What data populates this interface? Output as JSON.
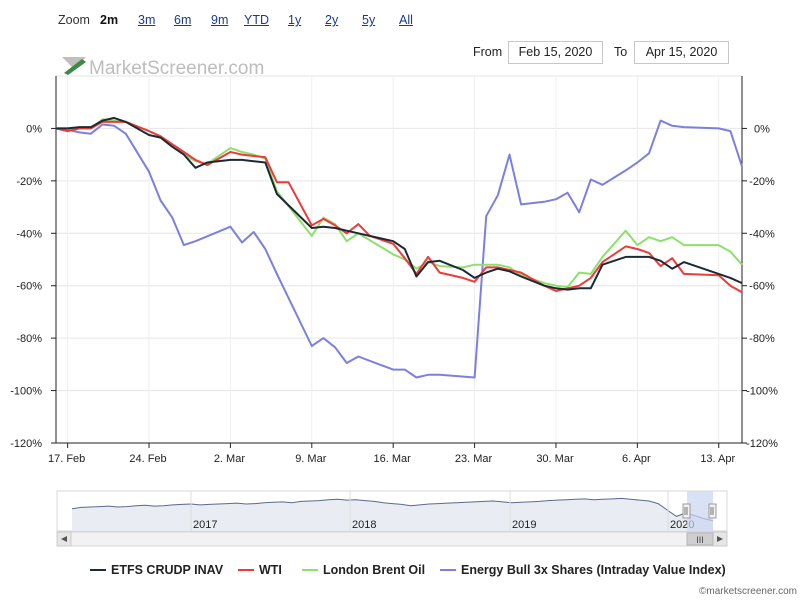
{
  "zoom": {
    "label": "Zoom",
    "buttons": [
      "2m",
      "3m",
      "6m",
      "9m",
      "YTD",
      "1y",
      "2y",
      "5y",
      "All"
    ],
    "active": "2m"
  },
  "range": {
    "from_label": "From",
    "from_value": "Feb 15, 2020",
    "to_label": "To",
    "to_value": "Apr 15, 2020"
  },
  "watermark": "MarketScreener.com",
  "credit": "©marketscreener.com",
  "colors": {
    "etfs": "#1c2a36",
    "wti": "#ee3a3a",
    "brent": "#8de06a",
    "energy": "#7b80e0",
    "navigator_fill": "#c9d6ef",
    "accent_logo": "#3c8a46"
  },
  "chart_data": {
    "type": "line",
    "title": "",
    "xlabel": "",
    "ylabel": "",
    "ylim": [
      -120,
      20
    ],
    "yticks": [
      "0%",
      "-20%",
      "-40%",
      "-60%",
      "-80%",
      "-100%",
      "-120%"
    ],
    "ytick_values": [
      0,
      -20,
      -40,
      -60,
      -80,
      -100,
      -120
    ],
    "xlim": [
      "2020-02-16",
      "2020-04-15"
    ],
    "xticks": [
      {
        "label": "17. Feb",
        "date": "2020-02-17"
      },
      {
        "label": "24. Feb",
        "date": "2020-02-24"
      },
      {
        "label": "2. Mar",
        "date": "2020-03-02"
      },
      {
        "label": "9. Mar",
        "date": "2020-03-09"
      },
      {
        "label": "16. Mar",
        "date": "2020-03-16"
      },
      {
        "label": "23. Mar",
        "date": "2020-03-23"
      },
      {
        "label": "30. Mar",
        "date": "2020-03-30"
      },
      {
        "label": "6. Apr",
        "date": "2020-04-06"
      },
      {
        "label": "13. Apr",
        "date": "2020-04-13"
      }
    ],
    "grid": true,
    "legend_position": "bottom",
    "series": [
      {
        "name": "ETFS CRUDP INAV",
        "key": "etfs",
        "points": [
          [
            "2020-02-16",
            0
          ],
          [
            "2020-02-17",
            0
          ],
          [
            "2020-02-18",
            0.5
          ],
          [
            "2020-02-19",
            0.5
          ],
          [
            "2020-02-20",
            3
          ],
          [
            "2020-02-21",
            4
          ],
          [
            "2020-02-22",
            2.5
          ],
          [
            "2020-02-24",
            -2.5
          ],
          [
            "2020-02-25",
            -3.5
          ],
          [
            "2020-02-26",
            -7
          ],
          [
            "2020-02-27",
            -10
          ],
          [
            "2020-02-28",
            -15
          ],
          [
            "2020-02-29",
            -13
          ],
          [
            "2020-03-02",
            -12
          ],
          [
            "2020-03-03",
            -12
          ],
          [
            "2020-03-04",
            -12.5
          ],
          [
            "2020-03-05",
            -13
          ],
          [
            "2020-03-06",
            -25
          ],
          [
            "2020-03-09",
            -38
          ],
          [
            "2020-03-10",
            -37.5
          ],
          [
            "2020-03-11",
            -38
          ],
          [
            "2020-03-12",
            -39
          ],
          [
            "2020-03-13",
            -40
          ],
          [
            "2020-03-16",
            -43
          ],
          [
            "2020-03-17",
            -46
          ],
          [
            "2020-03-18",
            -56.5
          ],
          [
            "2020-03-19",
            -51
          ],
          [
            "2020-03-20",
            -50.5
          ],
          [
            "2020-03-22",
            -54
          ],
          [
            "2020-03-23",
            -57
          ],
          [
            "2020-03-24",
            -55
          ],
          [
            "2020-03-25",
            -53.5
          ],
          [
            "2020-03-26",
            -54.5
          ],
          [
            "2020-03-27",
            -56.5
          ],
          [
            "2020-03-29",
            -60
          ],
          [
            "2020-03-30",
            -61
          ],
          [
            "2020-03-31",
            -61.5
          ],
          [
            "2020-04-01",
            -61
          ],
          [
            "2020-04-02",
            -61
          ],
          [
            "2020-04-03",
            -52
          ],
          [
            "2020-04-05",
            -49
          ],
          [
            "2020-04-06",
            -49
          ],
          [
            "2020-04-07",
            -49
          ],
          [
            "2020-04-08",
            -50.5
          ],
          [
            "2020-04-09",
            -53.5
          ],
          [
            "2020-04-10",
            -51
          ],
          [
            "2020-04-13",
            -55.5
          ],
          [
            "2020-04-14",
            -57
          ],
          [
            "2020-04-15",
            -59
          ]
        ]
      },
      {
        "name": "WTI",
        "key": "wti",
        "points": [
          [
            "2020-02-16",
            0
          ],
          [
            "2020-02-17",
            -1
          ],
          [
            "2020-02-18",
            0
          ],
          [
            "2020-02-19",
            0
          ],
          [
            "2020-02-20",
            2.5
          ],
          [
            "2020-02-21",
            2.5
          ],
          [
            "2020-02-22",
            2.5
          ],
          [
            "2020-02-24",
            -1
          ],
          [
            "2020-02-25",
            -3
          ],
          [
            "2020-02-26",
            -6
          ],
          [
            "2020-02-27",
            -9
          ],
          [
            "2020-02-28",
            -12
          ],
          [
            "2020-02-29",
            -14
          ],
          [
            "2020-03-02",
            -9
          ],
          [
            "2020-03-03",
            -10
          ],
          [
            "2020-03-04",
            -10.5
          ],
          [
            "2020-03-05",
            -11
          ],
          [
            "2020-03-06",
            -20.5
          ],
          [
            "2020-03-07",
            -20.5
          ],
          [
            "2020-03-09",
            -37
          ],
          [
            "2020-03-10",
            -34.5
          ],
          [
            "2020-03-11",
            -37
          ],
          [
            "2020-03-12",
            -40
          ],
          [
            "2020-03-13",
            -36.5
          ],
          [
            "2020-03-14",
            -41
          ],
          [
            "2020-03-16",
            -44
          ],
          [
            "2020-03-17",
            -49.5
          ],
          [
            "2020-03-18",
            -55.5
          ],
          [
            "2020-03-19",
            -49
          ],
          [
            "2020-03-20",
            -55
          ],
          [
            "2020-03-22",
            -57
          ],
          [
            "2020-03-23",
            -58.5
          ],
          [
            "2020-03-24",
            -53
          ],
          [
            "2020-03-25",
            -53
          ],
          [
            "2020-03-26",
            -54
          ],
          [
            "2020-03-27",
            -55
          ],
          [
            "2020-03-29",
            -60
          ],
          [
            "2020-03-30",
            -62
          ],
          [
            "2020-03-31",
            -61
          ],
          [
            "2020-04-01",
            -60
          ],
          [
            "2020-04-02",
            -57
          ],
          [
            "2020-04-03",
            -51
          ],
          [
            "2020-04-05",
            -45
          ],
          [
            "2020-04-06",
            -46
          ],
          [
            "2020-04-07",
            -47.5
          ],
          [
            "2020-04-08",
            -52.5
          ],
          [
            "2020-04-09",
            -49.5
          ],
          [
            "2020-04-10",
            -55.5
          ],
          [
            "2020-04-13",
            -56
          ],
          [
            "2020-04-14",
            -60
          ],
          [
            "2020-04-15",
            -62.5
          ]
        ]
      },
      {
        "name": "London Brent Oil",
        "key": "brent",
        "points": [
          [
            "2020-02-16",
            0
          ],
          [
            "2020-02-17",
            0
          ],
          [
            "2020-02-18",
            0
          ],
          [
            "2020-02-19",
            0
          ],
          [
            "2020-02-20",
            3.5
          ],
          [
            "2020-02-21",
            3
          ],
          [
            "2020-02-22",
            2.5
          ],
          [
            "2020-02-24",
            -1
          ],
          [
            "2020-02-25",
            -3
          ],
          [
            "2020-02-26",
            -6.5
          ],
          [
            "2020-02-27",
            -10
          ],
          [
            "2020-02-28",
            -12.5
          ],
          [
            "2020-02-29",
            -13.5
          ],
          [
            "2020-03-02",
            -7.5
          ],
          [
            "2020-03-03",
            -9
          ],
          [
            "2020-03-04",
            -10
          ],
          [
            "2020-03-05",
            -11.5
          ],
          [
            "2020-03-06",
            -24
          ],
          [
            "2020-03-09",
            -41
          ],
          [
            "2020-03-10",
            -34
          ],
          [
            "2020-03-11",
            -36.5
          ],
          [
            "2020-03-12",
            -43
          ],
          [
            "2020-03-13",
            -40
          ],
          [
            "2020-03-16",
            -48
          ],
          [
            "2020-03-17",
            -50
          ],
          [
            "2020-03-18",
            -53.5
          ],
          [
            "2020-03-19",
            -51
          ],
          [
            "2020-03-20",
            -52.5
          ],
          [
            "2020-03-22",
            -53
          ],
          [
            "2020-03-23",
            -52
          ],
          [
            "2020-03-24",
            -52
          ],
          [
            "2020-03-25",
            -52
          ],
          [
            "2020-03-26",
            -53
          ],
          [
            "2020-03-27",
            -56
          ],
          [
            "2020-03-29",
            -59
          ],
          [
            "2020-03-30",
            -60
          ],
          [
            "2020-03-31",
            -60.5
          ],
          [
            "2020-04-01",
            -55
          ],
          [
            "2020-04-02",
            -55.5
          ],
          [
            "2020-04-03",
            -49
          ],
          [
            "2020-04-05",
            -39
          ],
          [
            "2020-04-06",
            -44.5
          ],
          [
            "2020-04-07",
            -41.5
          ],
          [
            "2020-04-08",
            -43
          ],
          [
            "2020-04-09",
            -41.5
          ],
          [
            "2020-04-10",
            -44.5
          ],
          [
            "2020-04-13",
            -44.5
          ],
          [
            "2020-04-14",
            -47
          ],
          [
            "2020-04-15",
            -52
          ]
        ]
      },
      {
        "name": "Energy Bull 3x Shares (Intraday Value Index)",
        "key": "energy",
        "points": [
          [
            "2020-02-16",
            0
          ],
          [
            "2020-02-17",
            -0.5
          ],
          [
            "2020-02-18",
            -1.5
          ],
          [
            "2020-02-19",
            -2
          ],
          [
            "2020-02-20",
            1.5
          ],
          [
            "2020-02-21",
            1
          ],
          [
            "2020-02-22",
            -2
          ],
          [
            "2020-02-24",
            -16.5
          ],
          [
            "2020-02-25",
            -27.5
          ],
          [
            "2020-02-26",
            -34
          ],
          [
            "2020-02-27",
            -44.5
          ],
          [
            "2020-02-28",
            -43
          ],
          [
            "2020-03-02",
            -37.5
          ],
          [
            "2020-03-03",
            -43.5
          ],
          [
            "2020-03-04",
            -39.5
          ],
          [
            "2020-03-05",
            -46
          ],
          [
            "2020-03-06",
            -55.5
          ],
          [
            "2020-03-09",
            -83
          ],
          [
            "2020-03-10",
            -80
          ],
          [
            "2020-03-11",
            -83.5
          ],
          [
            "2020-03-12",
            -89.5
          ],
          [
            "2020-03-13",
            -87
          ],
          [
            "2020-03-16",
            -92
          ],
          [
            "2020-03-17",
            -92
          ],
          [
            "2020-03-18",
            -95
          ],
          [
            "2020-03-19",
            -94
          ],
          [
            "2020-03-20",
            -94
          ],
          [
            "2020-03-23",
            -95
          ],
          [
            "2020-03-24",
            -33.5
          ],
          [
            "2020-03-25",
            -25.5
          ],
          [
            "2020-03-26",
            -10
          ],
          [
            "2020-03-27",
            -29
          ],
          [
            "2020-03-29",
            -28
          ],
          [
            "2020-03-30",
            -27
          ],
          [
            "2020-03-31",
            -24.5
          ],
          [
            "2020-04-01",
            -32
          ],
          [
            "2020-04-02",
            -19.5
          ],
          [
            "2020-04-03",
            -21.5
          ],
          [
            "2020-04-05",
            -16
          ],
          [
            "2020-04-06",
            -13
          ],
          [
            "2020-04-07",
            -9.5
          ],
          [
            "2020-04-08",
            3
          ],
          [
            "2020-04-09",
            1
          ],
          [
            "2020-04-10",
            0.5
          ],
          [
            "2020-04-13",
            0
          ],
          [
            "2020-04-14",
            -1
          ],
          [
            "2020-04-15",
            -14.5
          ]
        ]
      }
    ]
  },
  "navigator": {
    "year_labels": [
      "2017",
      "2018",
      "2019",
      "2020"
    ],
    "values": [
      -52,
      -49,
      -48,
      -47,
      -46,
      -48,
      -47,
      -45,
      -44,
      -46,
      -45,
      -43,
      -42,
      -41,
      -43,
      -42,
      -41,
      -40,
      -39,
      -41,
      -40,
      -38,
      -37,
      -36,
      -38,
      -35,
      -34,
      -33,
      -31,
      -30,
      -32,
      -31,
      -33,
      -35,
      -38,
      -40,
      -42,
      -45,
      -43,
      -41,
      -40,
      -39,
      -38,
      -37,
      -36,
      -35,
      -34,
      -36,
      -38,
      -37,
      -36,
      -35,
      -33,
      -32,
      -31,
      -30,
      -29,
      -31,
      -30,
      -29,
      -28,
      -30,
      -32,
      -34,
      -40,
      -55,
      -70,
      -62,
      -68,
      -75,
      -80
    ],
    "scroll_mark": "III"
  },
  "legend": [
    {
      "key": "etfs",
      "label": "ETFS CRUDP INAV"
    },
    {
      "key": "wti",
      "label": "WTI"
    },
    {
      "key": "brent",
      "label": "London Brent Oil"
    },
    {
      "key": "energy",
      "label": "Energy Bull 3x Shares (Intraday Value Index)"
    }
  ]
}
